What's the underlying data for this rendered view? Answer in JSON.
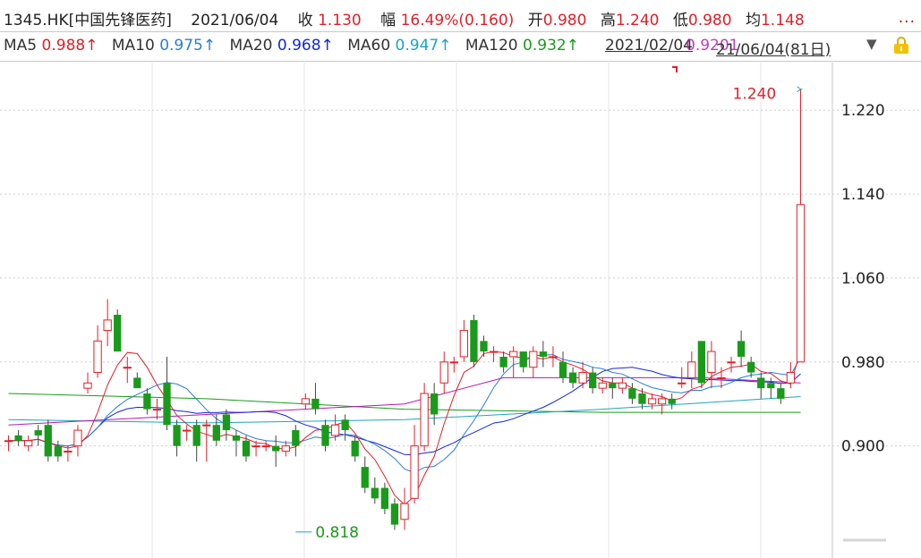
{
  "header": {
    "code": "1345.HK[中国先锋医药]",
    "date": "2021/06/04",
    "close_label": "收",
    "close": "1.130",
    "change_label": "幅",
    "change": "16.49%(0.160)",
    "open_label": "开",
    "open": "0.980",
    "high_label": "高",
    "high": "1.240",
    "low_label": "低",
    "low": "0.980",
    "avg_label": "均",
    "avg": "1.148",
    "more": "..."
  },
  "ma_row": {
    "items": [
      {
        "label": "MA5",
        "value": "0.988↑",
        "color": "#e0202a"
      },
      {
        "label": "MA10",
        "value": "0.975↑",
        "color": "#2a7fd0"
      },
      {
        "label": "MA20",
        "value": "0.968↑",
        "color": "#1428d8"
      },
      {
        "label": "MA60",
        "value": "0.947↑",
        "color": "#1aa6c0"
      },
      {
        "label": "MA120",
        "value": "0.932↑",
        "color": "#1a9a1a"
      }
    ],
    "overlay_a": "2021/02/04",
    "overlay_b": "0.9201",
    "overlay_c": "21/06/04(81日)",
    "dropdown": "▼"
  },
  "colors": {
    "up": "#e0202a",
    "down": "#1a9a1a",
    "ma5": "#e0202a",
    "ma10": "#2a7fd0",
    "ma20": "#1428d8",
    "ma60": "#1aa6c0",
    "ma120": "#1a9a1a",
    "ma250": "#b41ab4",
    "grid": "#c8c8c8"
  },
  "chart_data": {
    "type": "candlestick",
    "ylim": [
      0.8,
      1.25
    ],
    "yticks": [
      "1.220",
      "1.140",
      "1.060",
      "0.980",
      "0.900"
    ],
    "ytick_values": [
      1.22,
      1.14,
      1.06,
      0.98,
      0.9
    ],
    "annotations": {
      "high": {
        "value": "1.240",
        "index": 80
      },
      "low": {
        "value": "0.818",
        "index": 29
      }
    },
    "candles": [
      [
        0.905,
        0.905,
        0.91,
        0.895
      ],
      [
        0.91,
        0.905,
        0.915,
        0.9
      ],
      [
        0.9,
        0.905,
        0.91,
        0.895
      ],
      [
        0.915,
        0.91,
        0.92,
        0.9
      ],
      [
        0.92,
        0.89,
        0.925,
        0.885
      ],
      [
        0.9,
        0.89,
        0.905,
        0.885
      ],
      [
        0.895,
        0.895,
        0.9,
        0.885
      ],
      [
        0.9,
        0.915,
        0.92,
        0.89
      ],
      [
        0.955,
        0.96,
        0.97,
        0.95
      ],
      [
        0.97,
        1.0,
        1.015,
        0.965
      ],
      [
        1.01,
        1.02,
        1.04,
        0.995
      ],
      [
        1.025,
        0.99,
        1.03,
        0.99
      ],
      [
        0.975,
        0.975,
        0.985,
        0.96
      ],
      [
        0.965,
        0.955,
        0.97,
        0.955
      ],
      [
        0.95,
        0.935,
        0.955,
        0.93
      ],
      [
        0.935,
        0.935,
        0.945,
        0.925
      ],
      [
        0.96,
        0.92,
        0.985,
        0.915
      ],
      [
        0.92,
        0.9,
        0.925,
        0.89
      ],
      [
        0.915,
        0.915,
        0.92,
        0.905
      ],
      [
        0.92,
        0.9,
        0.925,
        0.885
      ],
      [
        0.92,
        0.92,
        0.925,
        0.885
      ],
      [
        0.92,
        0.905,
        0.93,
        0.9
      ],
      [
        0.93,
        0.915,
        0.935,
        0.905
      ],
      [
        0.91,
        0.905,
        0.915,
        0.89
      ],
      [
        0.905,
        0.89,
        0.91,
        0.885
      ],
      [
        0.9,
        0.9,
        0.905,
        0.89
      ],
      [
        0.9,
        0.9,
        0.905,
        0.895
      ],
      [
        0.9,
        0.895,
        0.91,
        0.88
      ],
      [
        0.895,
        0.9,
        0.905,
        0.89
      ],
      [
        0.915,
        0.9,
        0.92,
        0.89
      ],
      [
        0.94,
        0.945,
        0.95,
        0.935
      ],
      [
        0.945,
        0.935,
        0.96,
        0.93
      ],
      [
        0.92,
        0.9,
        0.925,
        0.895
      ],
      [
        0.91,
        0.92,
        0.93,
        0.905
      ],
      [
        0.925,
        0.915,
        0.93,
        0.905
      ],
      [
        0.905,
        0.89,
        0.91,
        0.885
      ],
      [
        0.88,
        0.86,
        0.89,
        0.855
      ],
      [
        0.86,
        0.85,
        0.87,
        0.845
      ],
      [
        0.86,
        0.84,
        0.865,
        0.835
      ],
      [
        0.845,
        0.825,
        0.85,
        0.82
      ],
      [
        0.83,
        0.845,
        0.86,
        0.82
      ],
      [
        0.85,
        0.9,
        0.92,
        0.845
      ],
      [
        0.9,
        0.95,
        0.96,
        0.895
      ],
      [
        0.95,
        0.93,
        0.96,
        0.92
      ],
      [
        0.96,
        0.98,
        0.99,
        0.95
      ],
      [
        0.98,
        0.98,
        0.985,
        0.97
      ],
      [
        0.985,
        1.01,
        1.02,
        0.98
      ],
      [
        1.02,
        0.98,
        1.025,
        0.975
      ],
      [
        1.0,
        0.99,
        1.005,
        0.985
      ],
      [
        0.99,
        0.99,
        0.995,
        0.98
      ],
      [
        0.985,
        0.975,
        0.99,
        0.97
      ],
      [
        0.985,
        0.99,
        0.995,
        0.965
      ],
      [
        0.99,
        0.975,
        0.99,
        0.97
      ],
      [
        0.975,
        0.99,
        0.995,
        0.965
      ],
      [
        0.99,
        0.985,
        1.0,
        0.975
      ],
      [
        0.985,
        0.985,
        0.995,
        0.975
      ],
      [
        0.98,
        0.965,
        0.99,
        0.96
      ],
      [
        0.97,
        0.96,
        0.975,
        0.955
      ],
      [
        0.96,
        0.97,
        0.98,
        0.955
      ],
      [
        0.97,
        0.955,
        0.975,
        0.95
      ],
      [
        0.955,
        0.96,
        0.965,
        0.95
      ],
      [
        0.96,
        0.955,
        0.965,
        0.945
      ],
      [
        0.955,
        0.96,
        0.965,
        0.95
      ],
      [
        0.955,
        0.945,
        0.96,
        0.94
      ],
      [
        0.95,
        0.94,
        0.955,
        0.935
      ],
      [
        0.94,
        0.945,
        0.95,
        0.935
      ],
      [
        0.94,
        0.945,
        0.95,
        0.93
      ],
      [
        0.945,
        0.94,
        0.95,
        0.935
      ],
      [
        0.96,
        0.96,
        0.975,
        0.955
      ],
      [
        0.965,
        0.98,
        0.99,
        0.955
      ],
      [
        1.0,
        0.96,
        1.0,
        0.955
      ],
      [
        0.97,
        0.99,
        1.0,
        0.955
      ],
      [
        0.965,
        0.965,
        0.975,
        0.955
      ],
      [
        0.98,
        0.98,
        0.985,
        0.97
      ],
      [
        1.0,
        0.985,
        1.01,
        0.975
      ],
      [
        0.98,
        0.97,
        0.985,
        0.965
      ],
      [
        0.965,
        0.955,
        0.97,
        0.945
      ],
      [
        0.96,
        0.955,
        0.965,
        0.945
      ],
      [
        0.955,
        0.945,
        0.96,
        0.94
      ],
      [
        0.96,
        0.97,
        0.98,
        0.955
      ],
      [
        0.98,
        1.13,
        1.24,
        0.98
      ]
    ]
  }
}
